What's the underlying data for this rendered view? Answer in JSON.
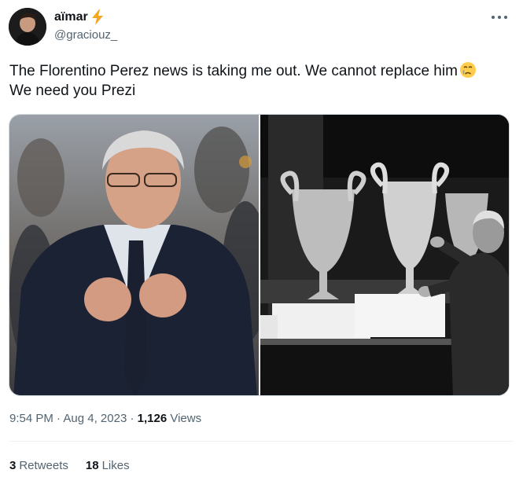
{
  "author": {
    "display_name": "aïmar",
    "handle": "@graciouz_",
    "verified_badge_icon": "lightning-bolt-icon"
  },
  "tweet": {
    "line1": "The Florentino Perez news is taking me out. We cannot replace him",
    "line1_emoji": "crying-face-icon",
    "line2": "We need you Prezi"
  },
  "meta": {
    "time": "9:54 PM",
    "separator": " · ",
    "date": "Aug 4, 2023",
    "views_count": "1,126",
    "views_label": "Views"
  },
  "stats": {
    "retweets_count": "3",
    "retweets_label": "Retweets",
    "likes_count": "18",
    "likes_label": "Likes"
  },
  "colors": {
    "text_primary": "#0f1419",
    "text_secondary": "#536471",
    "divider": "#eff3f4"
  }
}
